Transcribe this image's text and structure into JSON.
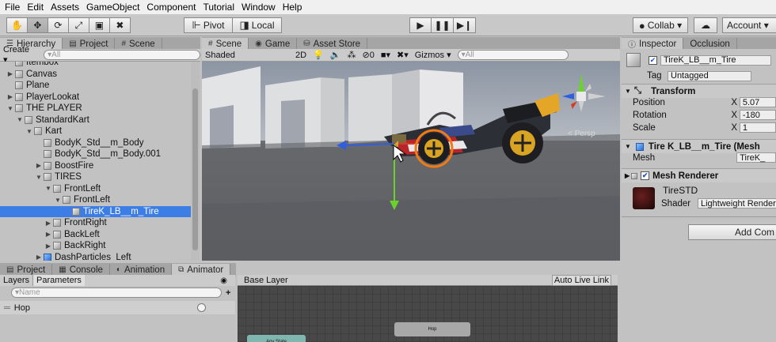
{
  "menu": [
    "File",
    "Edit",
    "Assets",
    "GameObject",
    "Component",
    "Tutorial",
    "Window",
    "Help"
  ],
  "toolbar": {
    "pivot_label": "Pivot",
    "local_label": "Local",
    "collab_label": "Collab ▾",
    "account_label": "Account ▾"
  },
  "hierarchy": {
    "tab_label": "Hierarchy",
    "create_label": "Create ▾",
    "search_placeholder": "▾All",
    "items": [
      {
        "label": "Itembox",
        "indent": 2,
        "arrow": "",
        "blue": false
      },
      {
        "label": "Canvas",
        "indent": 2,
        "arrow": "▶",
        "blue": false
      },
      {
        "label": "Plane",
        "indent": 2,
        "arrow": "",
        "blue": false
      },
      {
        "label": "PlayerLookat",
        "indent": 2,
        "arrow": "▶",
        "blue": false
      },
      {
        "label": "THE PLAYER",
        "indent": 2,
        "arrow": "▼",
        "blue": false
      },
      {
        "label": "StandardKart",
        "indent": 3,
        "arrow": "▼",
        "blue": false
      },
      {
        "label": "Kart",
        "indent": 4,
        "arrow": "▼",
        "blue": false
      },
      {
        "label": "BodyK_Std__m_Body",
        "indent": 5,
        "arrow": "",
        "blue": false
      },
      {
        "label": "BodyK_Std__m_Body.001",
        "indent": 5,
        "arrow": "",
        "blue": false
      },
      {
        "label": "BoostFire",
        "indent": 5,
        "arrow": "▶",
        "blue": false
      },
      {
        "label": "TIRES",
        "indent": 5,
        "arrow": "▼",
        "blue": false
      },
      {
        "label": "FrontLeft",
        "indent": 6,
        "arrow": "▼",
        "blue": false
      },
      {
        "label": "FrontLeft",
        "indent": 7,
        "arrow": "▼",
        "blue": false
      },
      {
        "label": "TireK_LB__m_Tire",
        "indent": 8,
        "arrow": "",
        "blue": false,
        "selected": true
      },
      {
        "label": "FrontRight",
        "indent": 6,
        "arrow": "▶",
        "blue": false
      },
      {
        "label": "BackLeft",
        "indent": 6,
        "arrow": "▶",
        "blue": false
      },
      {
        "label": "BackRight",
        "indent": 6,
        "arrow": "▶",
        "blue": false
      },
      {
        "label": "DashParticles_Left",
        "indent": 5,
        "arrow": "▶",
        "blue": true
      }
    ]
  },
  "project_tab": "Project",
  "scene_tab_small": "Scene",
  "scene": {
    "tabs": [
      "Scene",
      "Game",
      "Asset Store"
    ],
    "shaded_label": "Shaded",
    "mode_2d": "2D",
    "fx_count": "0",
    "gizmos_label": "Gizmos ▾",
    "search_placeholder": "▾All",
    "persp_label": "< Persp"
  },
  "inspector": {
    "tabs": [
      "Inspector",
      "Occlusion"
    ],
    "object_name": "TireK_LB__m_Tire",
    "tag_label": "Tag",
    "tag_value": "Untagged",
    "transform_title": "Transform",
    "position_label": "Position",
    "rotation_label": "Rotation",
    "scale_label": "Scale",
    "axis_x": "X",
    "position_x": "5.07",
    "rotation_x": "-180",
    "scale_x": "1",
    "meshfilter_title": "Tire K_LB__m_Tire (Mesh",
    "mesh_label": "Mesh",
    "mesh_value": "TireK_",
    "renderer_title": "Mesh Renderer",
    "material_name": "TireSTD",
    "shader_label": "Shader",
    "shader_value": "Lightweight Render Pip",
    "add_component_label": "Add Com"
  },
  "bottom": {
    "tabs": [
      "Project",
      "Console",
      "Animation",
      "Animator"
    ],
    "layers_tab": "Layers",
    "parameters_tab": "Parameters",
    "search_placeholder": "▾Name",
    "param_name": "Hop",
    "base_layer_label": "Base Layer",
    "auto_live_link": "Auto Live Link",
    "any_state_label": "Any State",
    "hop_state_label": "Hop"
  },
  "colors": {
    "selection": "#3d7de6",
    "axis_y": "#6bd12c",
    "axis_x": "#d63b26",
    "axis_z": "#2f5fe0",
    "tire_highlight": "#f07a14"
  }
}
